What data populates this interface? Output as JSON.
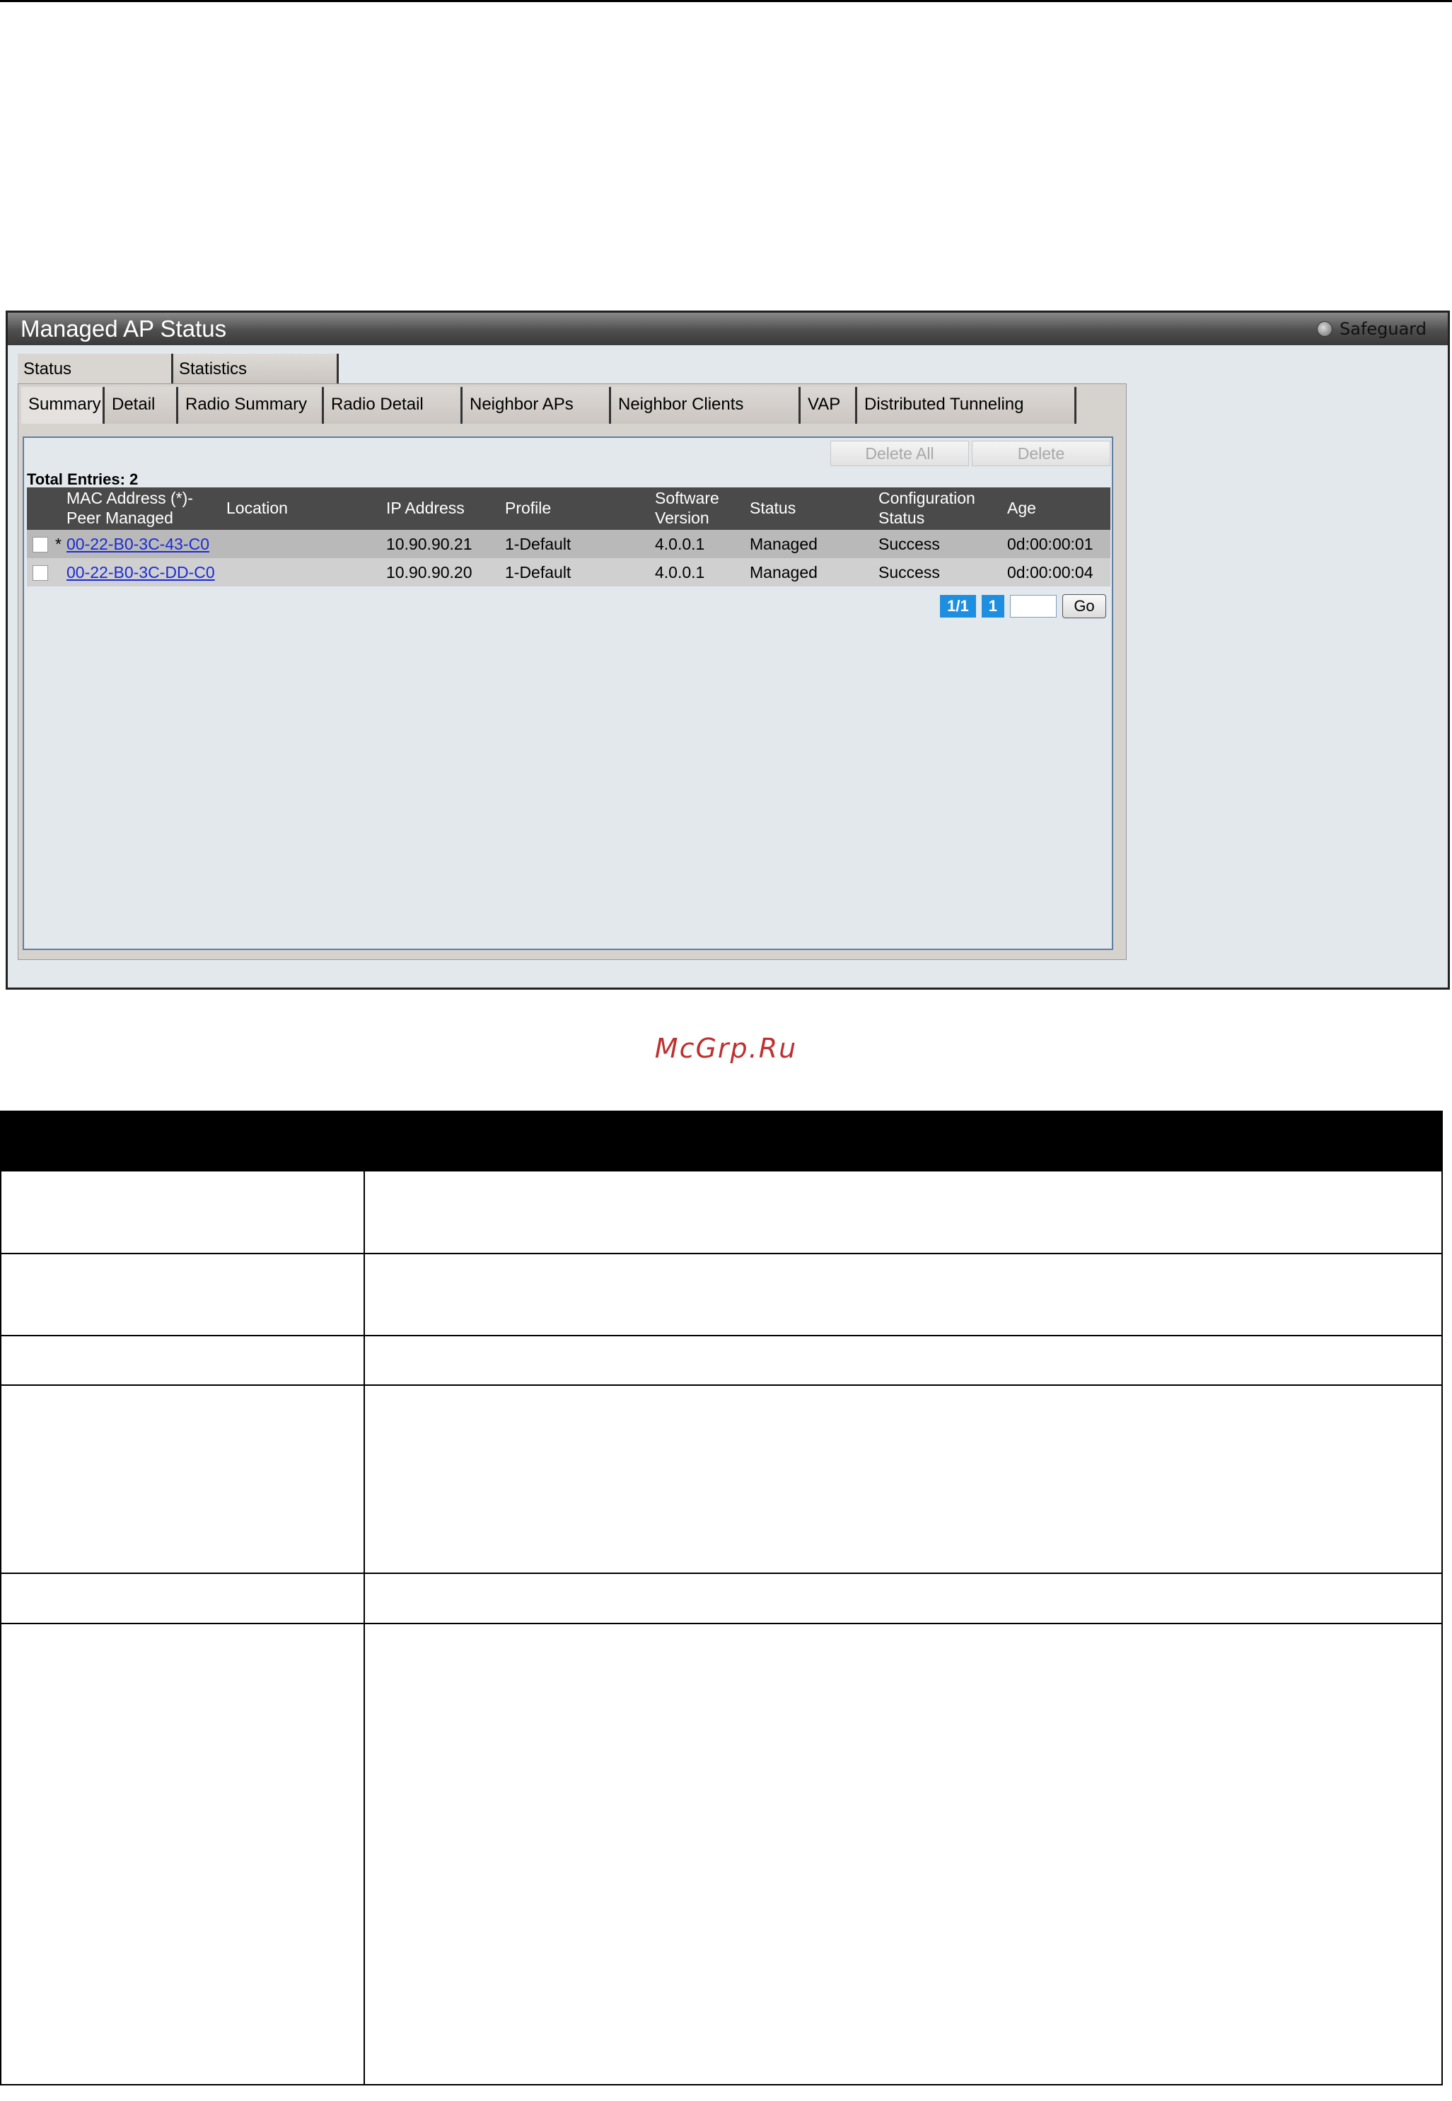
{
  "window": {
    "title": "Managed AP Status",
    "safeguard_label": "Safeguard"
  },
  "outer_tabs": [
    {
      "label": "Status",
      "active": true
    },
    {
      "label": "Statistics",
      "active": false
    }
  ],
  "inner_tabs": [
    {
      "label": "Summary",
      "active": true
    },
    {
      "label": "Detail"
    },
    {
      "label": "Radio Summary"
    },
    {
      "label": "Radio Detail"
    },
    {
      "label": "Neighbor APs"
    },
    {
      "label": "Neighbor Clients"
    },
    {
      "label": "VAP"
    },
    {
      "label": "Distributed Tunneling"
    }
  ],
  "buttons": {
    "delete_all": "Delete All",
    "delete": "Delete",
    "go": "Go"
  },
  "total_entries": "Total Entries: 2",
  "table": {
    "headers": {
      "mac_line1": "MAC Address (*)-",
      "mac_line2": "Peer Managed",
      "location": "Location",
      "ip": "IP Address",
      "profile": "Profile",
      "sw_line1": "Software",
      "sw_line2": "Version",
      "status": "Status",
      "cfg_line1": "Configuration",
      "cfg_line2": "Status",
      "age": "Age"
    },
    "rows": [
      {
        "marker": "*",
        "mac": "00-22-B0-3C-43-C0",
        "location": "",
        "ip": "10.90.90.21",
        "profile": "1-Default",
        "software": "4.0.0.1",
        "status": "Managed",
        "config_status": "Success",
        "age": "0d:00:00:01"
      },
      {
        "marker": "",
        "mac": "00-22-B0-3C-DD-C0",
        "location": "",
        "ip": "10.90.90.20",
        "profile": "1-Default",
        "software": "4.0.0.1",
        "status": "Managed",
        "config_status": "Success",
        "age": "0d:00:00:04"
      }
    ]
  },
  "pager": {
    "page_of": "1/1",
    "page": "1",
    "goto_value": ""
  },
  "watermark": "McGrp.Ru",
  "colors": {
    "title_bar": "#4e4e4e",
    "pager_blue": "#1e8fe0",
    "link": "#1a2bd6",
    "watermark": "#c03030"
  }
}
